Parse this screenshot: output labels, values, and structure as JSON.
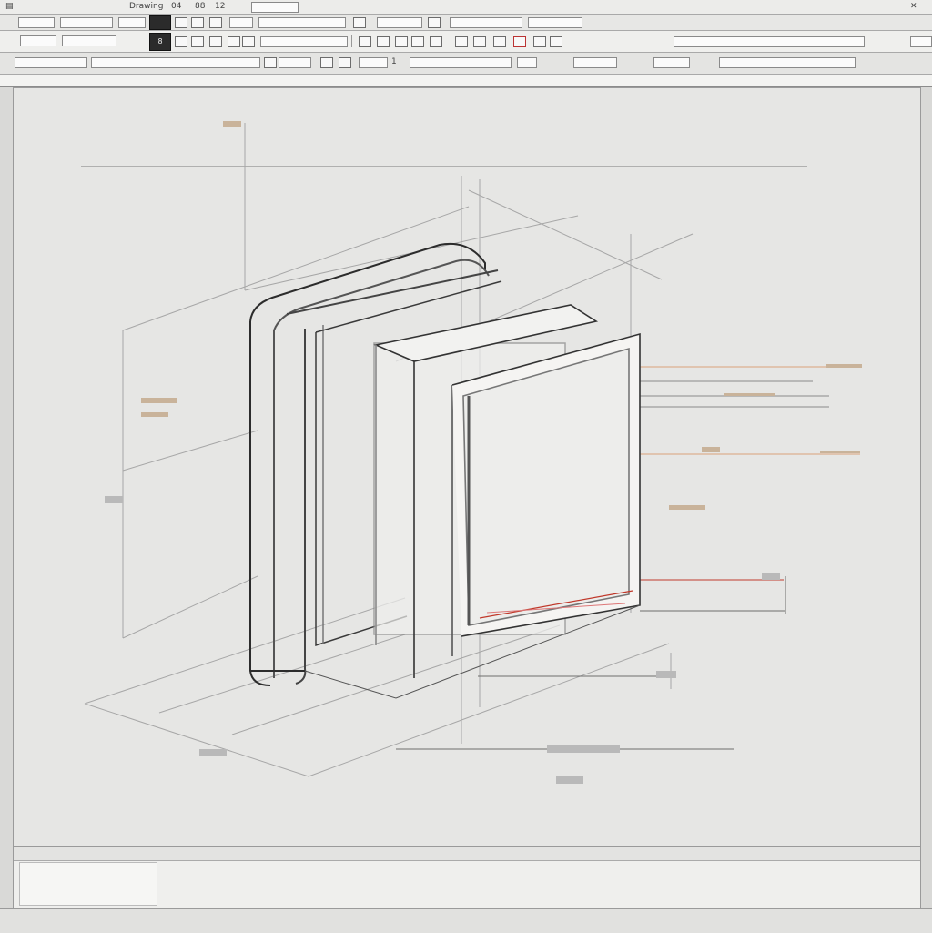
{
  "colors": {
    "canvas_bg": "#e6e6e4",
    "line_dark": "#2c2c2c",
    "line_mid": "#6d6d6d",
    "line_light": "#a7a7a7",
    "annotation_red": "#c0392b",
    "annotation_orange": "#d9a27a"
  },
  "menubar": {
    "items": [
      "Drawing",
      "04",
      "88",
      "12"
    ]
  },
  "toolbar2": {
    "icon_names": [
      "open-icon",
      "save-icon",
      "print-icon",
      "undo-icon",
      "redo-icon",
      "layer-icon",
      "snap-icon",
      "measure-icon",
      "grid-icon",
      "zoom-icon",
      "render-icon",
      "view3d-icon",
      "color-icon",
      "settings-icon"
    ],
    "dark_button_label": "8"
  },
  "ribbon": {
    "label_1": "1"
  },
  "drawing": {
    "object": "isometric-door-frame-sketch"
  },
  "panel": {
    "list_items": [
      "",
      "",
      "",
      "",
      ""
    ]
  },
  "status": {
    "left": "",
    "right": ""
  }
}
